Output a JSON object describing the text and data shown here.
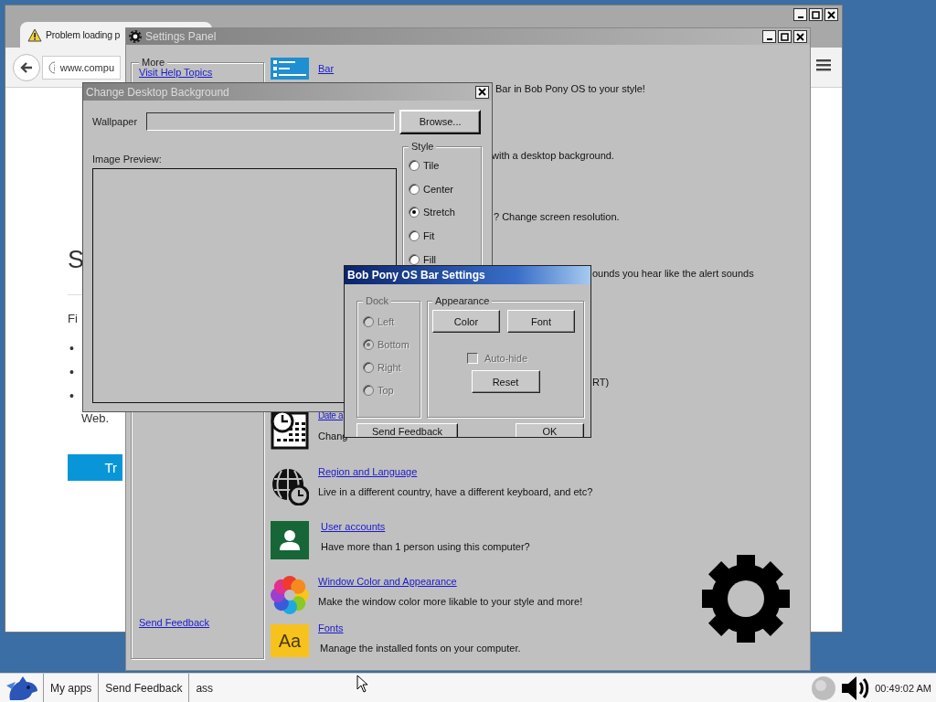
{
  "browser": {
    "tab": {
      "title": "Problem loading p",
      "selected": true
    },
    "address": "www.compu",
    "page": {
      "heading": "S",
      "intro": "Fi",
      "bullets": [
        "•",
        "•",
        "•"
      ],
      "trailing_text": "Web.",
      "button": "Tr"
    }
  },
  "settings_panel": {
    "title": "Settings Panel",
    "active": false,
    "sidebar": {
      "title": "More",
      "links": [
        "Visit Help Topics",
        "Send Feedback"
      ]
    },
    "items": [
      {
        "kind": "taskbar",
        "title": "Bar",
        "description": "Bar in Bob Pony OS to your style!"
      },
      {
        "description": "with a desktop background."
      },
      {
        "description": "? Change screen resolution."
      },
      {
        "description": "ounds you hear like the alert sounds"
      },
      {
        "description": "RT)"
      },
      {
        "kind": "calendar",
        "title": "Date a",
        "description": "Chang"
      },
      {
        "kind": "globe",
        "title": "Region and Language",
        "description": "Live in a different country, have a different keyboard, and etc?"
      },
      {
        "kind": "user",
        "title": "User accounts",
        "description": "Have more than 1 person using this computer?"
      },
      {
        "kind": "palette",
        "title": "Window Color and Appearance",
        "description": "Make the window color more likable to your style and more!"
      },
      {
        "kind": "fonts",
        "icon_text": "Aa",
        "title": "Fonts",
        "description": "Manage the installed fonts on your computer."
      }
    ]
  },
  "background_dialog": {
    "title": "Change Desktop Background",
    "active": false,
    "wallpaper_label": "Wallpaper",
    "browse_button": "Browse...",
    "preview_label": "Image Preview:",
    "style": {
      "title": "Style",
      "options": [
        {
          "label": "Tile",
          "selected": false
        },
        {
          "label": "Center",
          "selected": false
        },
        {
          "label": "Stretch",
          "selected": true
        },
        {
          "label": "Fit",
          "selected": false
        },
        {
          "label": "Fill",
          "selected": false
        }
      ]
    }
  },
  "bar_dialog": {
    "title": "Bob Pony OS Bar Settings",
    "active": true,
    "dock": {
      "title": "Dock",
      "disabled": true,
      "options": [
        {
          "label": "Left",
          "selected": false
        },
        {
          "label": "Bottom",
          "selected": true
        },
        {
          "label": "Right",
          "selected": false
        },
        {
          "label": "Top",
          "selected": false
        }
      ]
    },
    "appearance": {
      "title": "Appearance",
      "buttons": [
        "Color",
        "Font"
      ],
      "auto_hide": {
        "label": "Auto-hide",
        "checked": false,
        "disabled": true
      },
      "reset_button": "Reset"
    },
    "footer_buttons": [
      "Send Feedback",
      "OK"
    ]
  },
  "taskbar": {
    "items": [
      "My apps",
      "Send Feedback",
      "ass"
    ],
    "clock": "00:49:02 AM"
  }
}
